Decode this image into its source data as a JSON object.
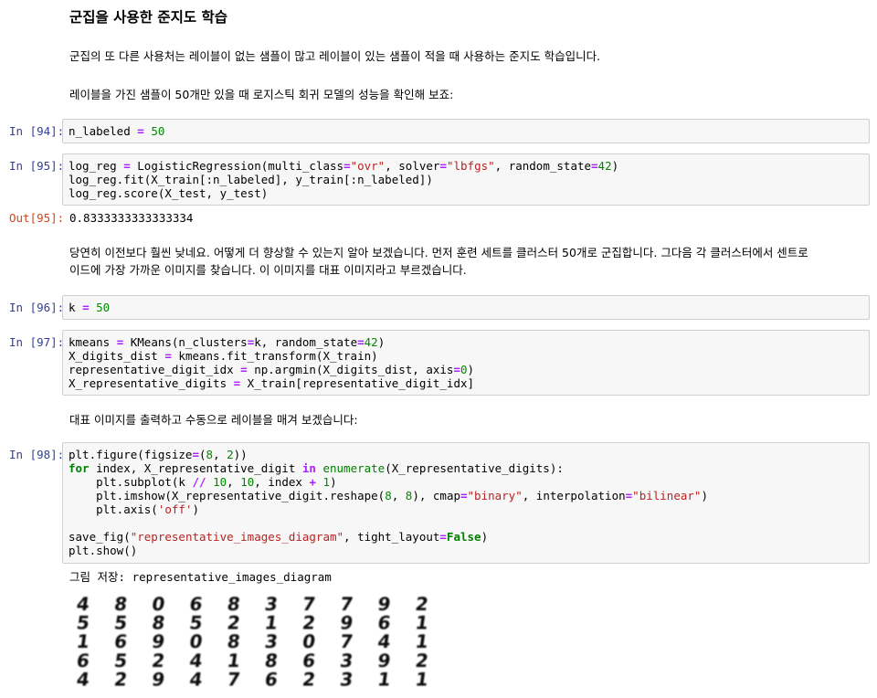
{
  "markdown": {
    "heading": "군집을 사용한 준지도 학습",
    "p1": "군집의 또 다른 사용처는 레이블이 없는 샘플이 많고 레이블이 있는 샘플이 적을 때 사용하는 준지도 학습입니다.",
    "p2": "레이블을 가진 샘플이 50개만 있을 때 로지스틱 회귀 모델의 성능을 확인해 보죠:",
    "p3_line1": "당연히 이전보다 훨씬 낮네요. 어떻게 더 향상할 수 있는지 알아 보겠습니다. 먼저 훈련 세트를 클러스터 50개로 군집합니다. 그다음 각 클러스터에서 센트로",
    "p3_line2": "이드에 가장 가까운 이미지를 찾습니다. 이 이미지를 대표 이미지라고 부르겠습니다.",
    "p4": "대표 이미지를 출력하고 수동으로 레이블을 매겨 보겠습니다:"
  },
  "cells": {
    "c94": {
      "prompt": "In [94]:",
      "tokens": [
        [
          [
            "n_labeled ",
            ""
          ],
          [
            "=",
            "o"
          ],
          [
            " ",
            ""
          ],
          [
            "50",
            "n"
          ]
        ]
      ]
    },
    "c95": {
      "prompt": "In [95]:",
      "tokens": [
        [
          [
            "log_reg ",
            ""
          ],
          [
            "=",
            "o"
          ],
          [
            " LogisticRegression(multi_class",
            ""
          ],
          [
            "=",
            "o"
          ],
          [
            "\"ovr\"",
            "s"
          ],
          [
            ", solver",
            ""
          ],
          [
            "=",
            "o"
          ],
          [
            "\"lbfgs\"",
            "s"
          ],
          [
            ", random_state",
            ""
          ],
          [
            "=",
            "o"
          ],
          [
            "42",
            "n"
          ],
          [
            ")",
            ""
          ]
        ],
        [
          [
            "log_reg.fit(X_train[:n_labeled], y_train[:n_labeled])",
            ""
          ]
        ],
        [
          [
            "log_reg.score(X_test, y_test)",
            ""
          ]
        ]
      ],
      "out_prompt": "Out[95]:",
      "out_text": "0.8333333333333334"
    },
    "c96": {
      "prompt": "In [96]:",
      "tokens": [
        [
          [
            "k ",
            ""
          ],
          [
            "=",
            "o"
          ],
          [
            " ",
            ""
          ],
          [
            "50",
            "n"
          ]
        ]
      ]
    },
    "c97": {
      "prompt": "In [97]:",
      "tokens": [
        [
          [
            "kmeans ",
            ""
          ],
          [
            "=",
            "o"
          ],
          [
            " KMeans(n_clusters",
            ""
          ],
          [
            "=",
            "o"
          ],
          [
            "k, random_state",
            ""
          ],
          [
            "=",
            "o"
          ],
          [
            "42",
            "n"
          ],
          [
            ")",
            ""
          ]
        ],
        [
          [
            "X_digits_dist ",
            ""
          ],
          [
            "=",
            "o"
          ],
          [
            " kmeans.fit_transform(X_train)",
            ""
          ]
        ],
        [
          [
            "representative_digit_idx ",
            ""
          ],
          [
            "=",
            "o"
          ],
          [
            " np.argmin(X_digits_dist, axis",
            ""
          ],
          [
            "=",
            "o"
          ],
          [
            "0",
            "n"
          ],
          [
            ")",
            ""
          ]
        ],
        [
          [
            "X_representative_digits ",
            ""
          ],
          [
            "=",
            "o"
          ],
          [
            " X_train[representative_digit_idx]",
            ""
          ]
        ]
      ]
    },
    "c98": {
      "prompt": "In [98]:",
      "tokens": [
        [
          [
            "plt.figure(figsize",
            ""
          ],
          [
            "=",
            "o"
          ],
          [
            "(",
            ""
          ],
          [
            "8",
            "n"
          ],
          [
            ", ",
            ""
          ],
          [
            "2",
            "n"
          ],
          [
            "))",
            ""
          ]
        ],
        [
          [
            "for",
            "k"
          ],
          [
            " index, X_representative_digit ",
            ""
          ],
          [
            "in",
            "o"
          ],
          [
            " ",
            ""
          ],
          [
            "enumerate",
            "k2"
          ],
          [
            "(X_representative_digits):",
            ""
          ]
        ],
        [
          [
            "    plt.subplot(k ",
            ""
          ],
          [
            "//",
            "o"
          ],
          [
            " ",
            ""
          ],
          [
            "10",
            "n"
          ],
          [
            ", ",
            ""
          ],
          [
            "10",
            "n"
          ],
          [
            ", index ",
            ""
          ],
          [
            "+",
            "o"
          ],
          [
            " ",
            ""
          ],
          [
            "1",
            "n"
          ],
          [
            ")",
            ""
          ]
        ],
        [
          [
            "    plt.imshow(X_representative_digit.reshape(",
            ""
          ],
          [
            "8",
            "n"
          ],
          [
            ", ",
            ""
          ],
          [
            "8",
            "n"
          ],
          [
            "), cmap",
            ""
          ],
          [
            "=",
            "o"
          ],
          [
            "\"binary\"",
            "s"
          ],
          [
            ", interpolation",
            ""
          ],
          [
            "=",
            "o"
          ],
          [
            "\"bilinear\"",
            "s"
          ],
          [
            ")",
            ""
          ]
        ],
        [
          [
            "    plt.axis(",
            ""
          ],
          [
            "'off'",
            "s"
          ],
          [
            ")",
            ""
          ]
        ],
        [
          [
            "",
            ""
          ]
        ],
        [
          [
            "save_fig(",
            ""
          ],
          [
            "\"representative_images_diagram\"",
            "s"
          ],
          [
            ", tight_layout",
            ""
          ],
          [
            "=",
            "o"
          ],
          [
            "False",
            "k"
          ],
          [
            ")",
            ""
          ]
        ],
        [
          [
            "plt.show()",
            ""
          ]
        ]
      ],
      "out_text": "그림 저장: representative_images_diagram"
    }
  },
  "digit_grid": {
    "rows": [
      [
        "4",
        "8",
        "0",
        "6",
        "8",
        "3",
        "7",
        "7",
        "9",
        "2"
      ],
      [
        "5",
        "5",
        "8",
        "5",
        "2",
        "1",
        "2",
        "9",
        "6",
        "1"
      ],
      [
        "1",
        "6",
        "9",
        "0",
        "8",
        "3",
        "0",
        "7",
        "4",
        "1"
      ],
      [
        "6",
        "5",
        "2",
        "4",
        "1",
        "8",
        "6",
        "3",
        "9",
        "2"
      ],
      [
        "4",
        "2",
        "9",
        "4",
        "7",
        "6",
        "2",
        "3",
        "1",
        "1"
      ]
    ]
  }
}
